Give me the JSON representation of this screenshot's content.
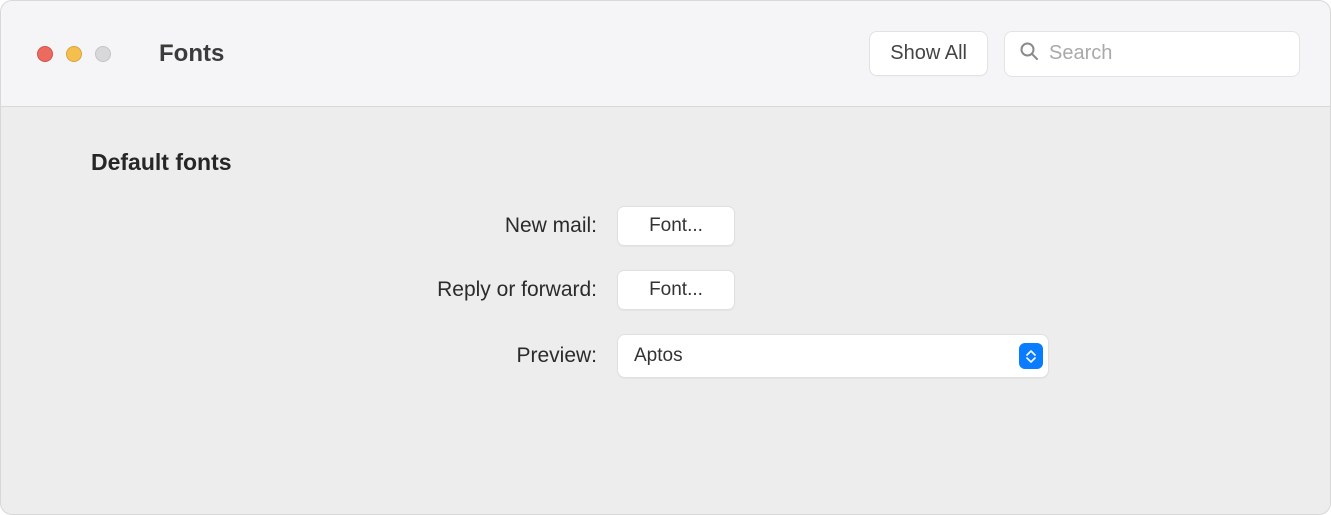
{
  "window": {
    "title": "Fonts"
  },
  "toolbar": {
    "show_all_label": "Show All",
    "search_placeholder": "Search"
  },
  "section": {
    "title": "Default fonts",
    "rows": {
      "new_mail": {
        "label": "New mail:",
        "button": "Font..."
      },
      "reply_forward": {
        "label": "Reply or forward:",
        "button": "Font..."
      },
      "preview": {
        "label": "Preview:",
        "value": "Aptos"
      }
    }
  }
}
